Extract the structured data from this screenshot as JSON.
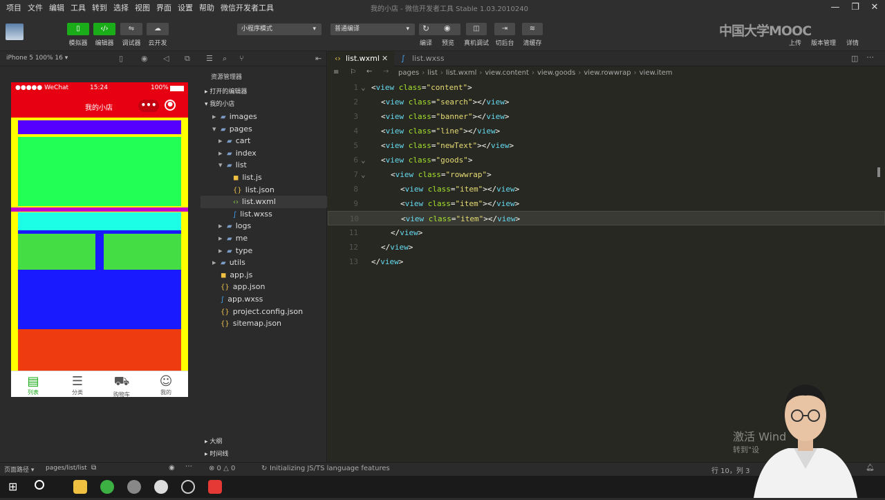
{
  "menu": [
    "项目",
    "文件",
    "编辑",
    "工具",
    "转到",
    "选择",
    "视图",
    "界面",
    "设置",
    "帮助",
    "微信开发者工具"
  ],
  "window_title": "我的小店 - 微信开发者工具 Stable 1.03.2010240",
  "toolbar": {
    "buttons": [
      {
        "label": "模拟器"
      },
      {
        "label": "编辑器"
      },
      {
        "label": "调试器"
      },
      {
        "label": "云开发"
      }
    ],
    "mode_select": "小程序模式",
    "compile_select": "普通编译",
    "actions": [
      {
        "label": "编译"
      },
      {
        "label": "预览"
      },
      {
        "label": "真机调试"
      },
      {
        "label": "切后台"
      },
      {
        "label": "清缓存"
      }
    ],
    "right": [
      {
        "label": "上传"
      },
      {
        "label": "版本管理"
      },
      {
        "label": "详情"
      }
    ]
  },
  "brand": "中国大学MOOC",
  "simulator": {
    "device": "iPhone 5 100% 16 ▾",
    "status": {
      "carrier": "●●●●● WeChat",
      "time": "15:24",
      "battery": "100%"
    },
    "nav_title": "我的小店",
    "tabs": [
      {
        "label": "列表"
      },
      {
        "label": "分类"
      },
      {
        "label": "购物车"
      },
      {
        "label": "我的"
      }
    ]
  },
  "explorer": {
    "title": "资源管理器",
    "sections": {
      "open_editors": "打开的编辑器",
      "project": "我的小店",
      "outline": "大纲",
      "timeline": "时间线"
    },
    "items": [
      {
        "label": "images",
        "type": "folder",
        "depth": 1
      },
      {
        "label": "pages",
        "type": "folder-open",
        "depth": 1
      },
      {
        "label": "cart",
        "type": "folder",
        "depth": 2
      },
      {
        "label": "index",
        "type": "folder",
        "depth": 2
      },
      {
        "label": "list",
        "type": "folder-open",
        "depth": 2
      },
      {
        "label": "list.js",
        "type": "js",
        "depth": 3
      },
      {
        "label": "list.json",
        "type": "json",
        "depth": 3
      },
      {
        "label": "list.wxml",
        "type": "wxml",
        "depth": 3
      },
      {
        "label": "list.wxss",
        "type": "wxss",
        "depth": 3
      },
      {
        "label": "logs",
        "type": "folder",
        "depth": 2
      },
      {
        "label": "me",
        "type": "folder",
        "depth": 2
      },
      {
        "label": "type",
        "type": "folder",
        "depth": 2
      },
      {
        "label": "utils",
        "type": "folder",
        "depth": 1
      },
      {
        "label": "app.js",
        "type": "js",
        "depth": 1
      },
      {
        "label": "app.json",
        "type": "json",
        "depth": 1
      },
      {
        "label": "app.wxss",
        "type": "wxss",
        "depth": 1
      },
      {
        "label": "project.config.json",
        "type": "json",
        "depth": 1
      },
      {
        "label": "sitemap.json",
        "type": "json",
        "depth": 1
      }
    ]
  },
  "editor": {
    "tabs": [
      {
        "label": "list.wxml",
        "active": true
      },
      {
        "label": "list.wxss",
        "active": false
      }
    ],
    "breadcrumb": [
      "pages",
      "list",
      "list.wxml",
      "view.content",
      "view.goods",
      "view.rowwrap",
      "view.item"
    ],
    "lines": [
      {
        "n": "1",
        "indent": 0,
        "cls": "content",
        "close": false
      },
      {
        "n": "2",
        "indent": 1,
        "cls": "search",
        "close": true
      },
      {
        "n": "3",
        "indent": 1,
        "cls": "banner",
        "close": true
      },
      {
        "n": "4",
        "indent": 1,
        "cls": "line",
        "close": true
      },
      {
        "n": "5",
        "indent": 1,
        "cls": "newText",
        "close": true
      },
      {
        "n": "6",
        "indent": 1,
        "cls": "goods",
        "close": false
      },
      {
        "n": "7",
        "indent": 2,
        "cls": "rowwrap",
        "close": false
      },
      {
        "n": "8",
        "indent": 3,
        "cls": "item",
        "close": true
      },
      {
        "n": "9",
        "indent": 3,
        "cls": "item",
        "close": true
      },
      {
        "n": "10",
        "indent": 3,
        "cls": "item",
        "close": true
      },
      {
        "n": "11",
        "indent": 2,
        "end": true
      },
      {
        "n": "12",
        "indent": 1,
        "end": true
      },
      {
        "n": "13",
        "indent": 0,
        "end": true
      }
    ]
  },
  "status": {
    "path_label": "页面路径 ▾",
    "path": "pages/list/list",
    "errors": "⊗ 0 △ 0",
    "message": "Initializing JS/TS language features",
    "position": "行 10，列 3"
  },
  "watermark": {
    "line1": "激活 Wind",
    "line2": "转到\"设"
  },
  "colors": {
    "accent": "#1aad19",
    "nav": "#e60012"
  }
}
